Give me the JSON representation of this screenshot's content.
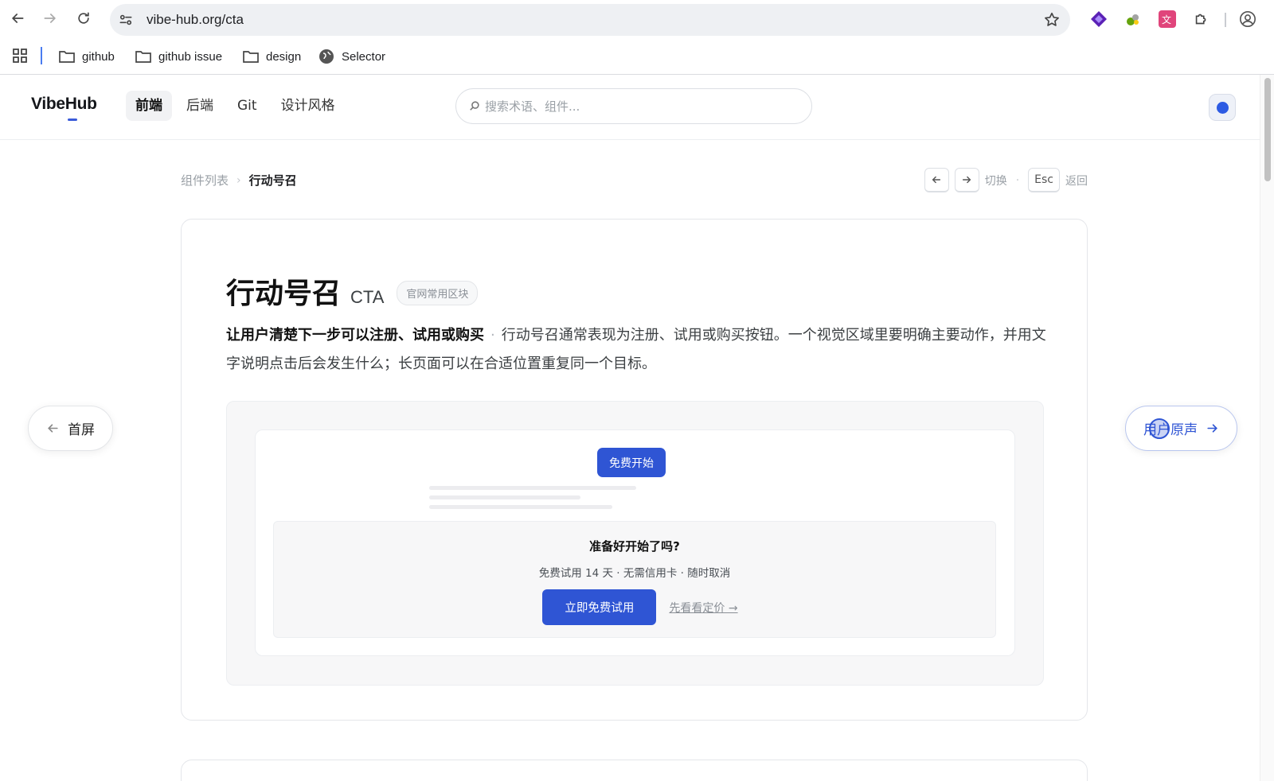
{
  "browser": {
    "url": "vibe-hub.org/cta",
    "bookmarks": [
      {
        "label": "github",
        "icon": "folder-icon"
      },
      {
        "label": "github issue",
        "icon": "folder-icon"
      },
      {
        "label": "design",
        "icon": "folder-icon"
      },
      {
        "label": "Selector",
        "icon": "globe-icon"
      }
    ]
  },
  "header": {
    "logo": "VibeHub",
    "tabs": [
      {
        "label": "前端",
        "active": true
      },
      {
        "label": "后端",
        "active": false
      },
      {
        "label": "Git",
        "active": false
      },
      {
        "label": "设计风格",
        "active": false
      }
    ],
    "search_placeholder": "搜索术语、组件..."
  },
  "breadcrumb": {
    "root": "组件列表",
    "current": "行动号召"
  },
  "shortcuts": {
    "switch_label": "切换",
    "esc_key": "Esc",
    "back_label": "返回"
  },
  "component": {
    "title_zh": "行动号召",
    "title_en": "CTA",
    "tag": "官网常用区块",
    "lead": "让用户清楚下一步可以注册、试用或购买",
    "separator": "·",
    "description": "行动号召通常表现为注册、试用或购买按钮。一个视觉区域里要明确主要动作，并用文字说明点击后会发生什么；长页面可以在合适位置重复同一个目标。"
  },
  "preview": {
    "top_button": "免费开始",
    "cta_title": "准备好开始了吗?",
    "cta_subtitle": "免费试用 14 天 · 无需信用卡 · 随时取消",
    "primary_button": "立即免费试用",
    "secondary_link": "先看看定价 →"
  },
  "pager": {
    "prev_label": "首屏",
    "next_label": "用户原声"
  },
  "colors": {
    "accent": "#2f55d4",
    "page_bg": "#ffffff",
    "preview_bg": "#f7f7f8"
  }
}
